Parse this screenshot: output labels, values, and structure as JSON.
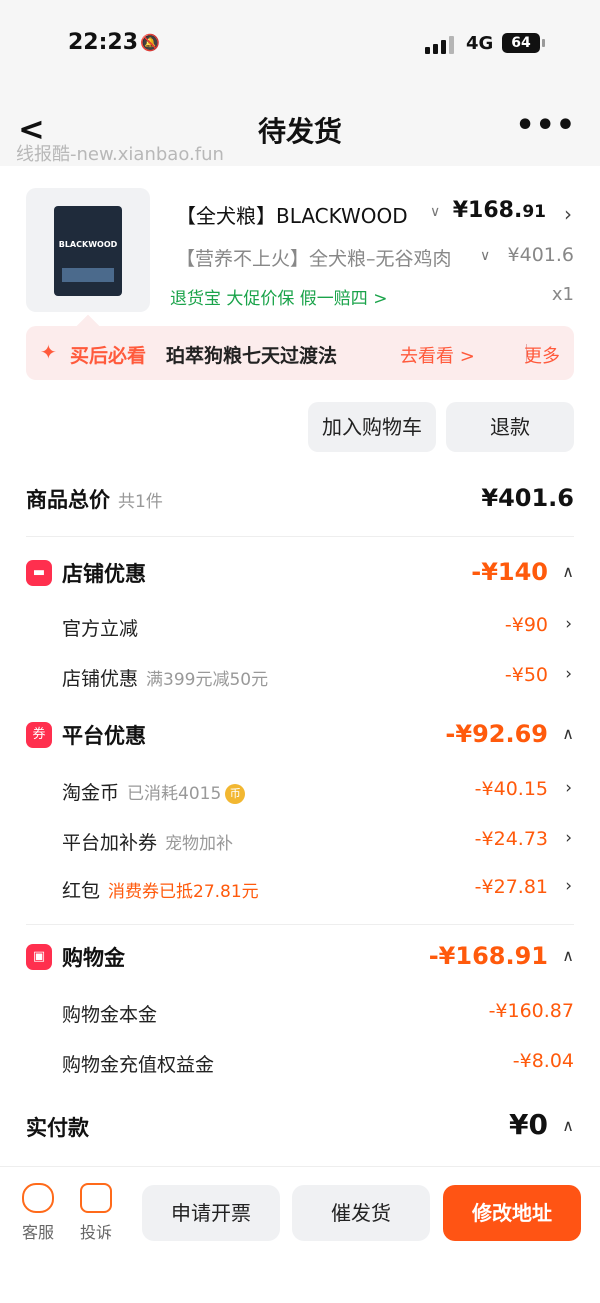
{
  "status": {
    "time": "22:23",
    "network": "4G",
    "battery": "64"
  },
  "nav": {
    "title": "待发货",
    "back_icon": "chevron-left-icon",
    "more_icon": "more-dots-icon"
  },
  "watermark": "线报酷-new.xianbao.fun",
  "product": {
    "title": "【全犬粮】BLACKWOOD",
    "price_main": "¥168.",
    "price_cents": "91",
    "spec": "【营养不上火】全犬粮–无谷鸡肉",
    "original_price": "¥401.6",
    "tags": "退货宝  大促价保  假一赔四 >",
    "quantity": "x1",
    "brand_on_package": "BLACKWOOD"
  },
  "tip": {
    "label": "买后必看",
    "text": "珀萃狗粮七天过渡法",
    "go": "去看看 >",
    "more": "更多"
  },
  "actions": {
    "add_to_cart": "加入购物车",
    "refund": "退款"
  },
  "summary": {
    "total_label": "商品总价",
    "count": "共1件",
    "total": "¥401.6",
    "shop": {
      "label": "店铺优惠",
      "amount": "-¥140",
      "items": [
        {
          "label": "官方立减",
          "note": "",
          "amount": "-¥90"
        },
        {
          "label": "店铺优惠",
          "note": "满399元减50元",
          "amount": "-¥50"
        }
      ]
    },
    "platform": {
      "label": "平台优惠",
      "amount": "-¥92.69",
      "items": [
        {
          "label": "淘金币",
          "note": "已消耗4015",
          "amount": "-¥40.15"
        },
        {
          "label": "平台加补券",
          "note": "宠物加补",
          "amount": "-¥24.73"
        },
        {
          "label": "红包",
          "note": "消费券已抵27.81元",
          "amount": "-¥27.81"
        }
      ]
    },
    "shopping_credit": {
      "label": "购物金",
      "amount": "-¥168.91",
      "items": [
        {
          "label": "购物金本金",
          "amount": "-¥160.87"
        },
        {
          "label": "购物金充值权益金",
          "amount": "-¥8.04"
        }
      ]
    },
    "paid_label": "实付款",
    "paid": "¥0"
  },
  "footer": {
    "service": "客服",
    "complain": "投诉",
    "invoice": "申请开票",
    "urge": "催发货",
    "change_address": "修改地址"
  },
  "colors": {
    "accent": "#ff5414",
    "discount": "#ff5a0c",
    "green": "#1aa34a",
    "badge": "#ff2f4e"
  }
}
